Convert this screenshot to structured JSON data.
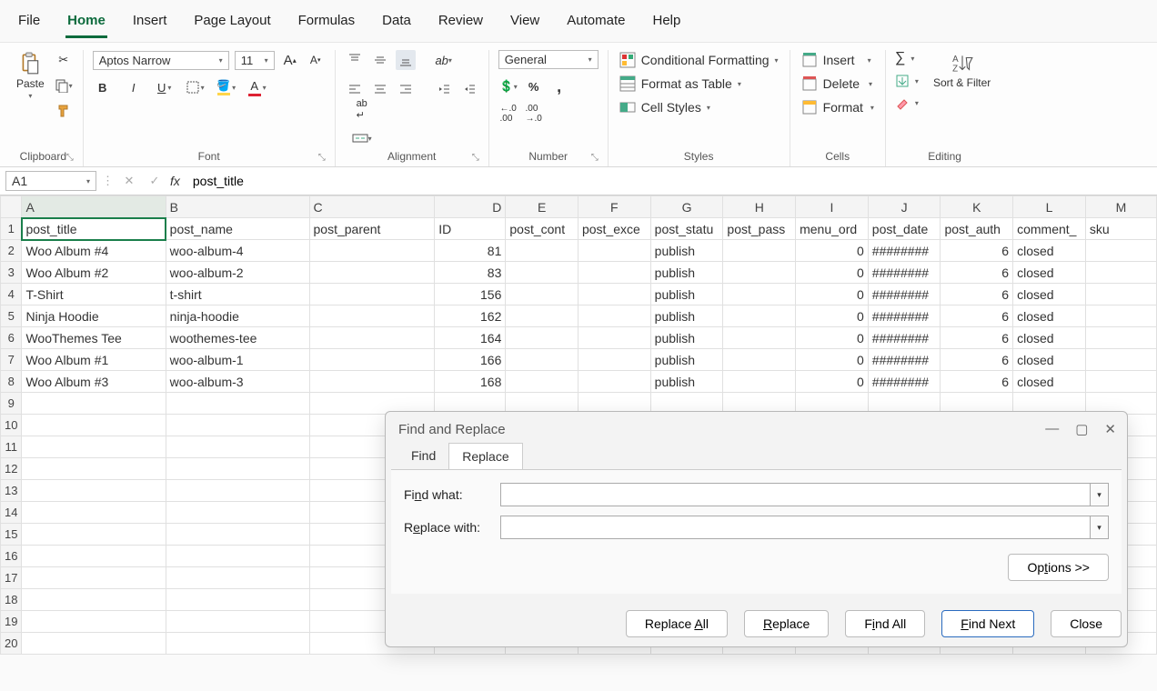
{
  "menu": {
    "tabs": [
      "File",
      "Home",
      "Insert",
      "Page Layout",
      "Formulas",
      "Data",
      "Review",
      "View",
      "Automate",
      "Help"
    ],
    "active": "Home"
  },
  "ribbon": {
    "clipboard": {
      "paste": "Paste",
      "label": "Clipboard"
    },
    "font": {
      "name": "Aptos Narrow",
      "size": "11",
      "label": "Font"
    },
    "alignment": {
      "label": "Alignment"
    },
    "number": {
      "format": "General",
      "label": "Number"
    },
    "styles": {
      "cond": "Conditional Formatting",
      "table": "Format as Table",
      "cell": "Cell Styles",
      "label": "Styles"
    },
    "cells": {
      "insert": "Insert",
      "delete": "Delete",
      "format": "Format",
      "label": "Cells"
    },
    "editing": {
      "sort": "Sort & Filter",
      "label": "Editing"
    }
  },
  "formula_bar": {
    "name_box": "A1",
    "formula": "post_title"
  },
  "columns": [
    "A",
    "B",
    "C",
    "D",
    "E",
    "F",
    "G",
    "H",
    "I",
    "J",
    "K",
    "L",
    "M"
  ],
  "headers": [
    "post_title",
    "post_name",
    "post_parent",
    "ID",
    "post_cont",
    "post_exce",
    "post_statu",
    "post_pass",
    "menu_ord",
    "post_date",
    "post_auth",
    "comment_",
    "sku"
  ],
  "rows": [
    {
      "A": "Woo Album #4",
      "B": "woo-album-4",
      "C": "",
      "D": "81",
      "E": "",
      "F": "",
      "G": "publish",
      "H": "",
      "I": "0",
      "J": "########",
      "K": "6",
      "L": "closed",
      "M": ""
    },
    {
      "A": "Woo Album #2",
      "B": "woo-album-2",
      "C": "",
      "D": "83",
      "E": "",
      "F": "",
      "G": "publish",
      "H": "",
      "I": "0",
      "J": "########",
      "K": "6",
      "L": "closed",
      "M": ""
    },
    {
      "A": "T-Shirt",
      "B": "t-shirt",
      "C": "",
      "D": "156",
      "E": "",
      "F": "",
      "G": "publish",
      "H": "",
      "I": "0",
      "J": "########",
      "K": "6",
      "L": "closed",
      "M": ""
    },
    {
      "A": "Ninja Hoodie",
      "B": "ninja-hoodie",
      "C": "",
      "D": "162",
      "E": "",
      "F": "",
      "G": "publish",
      "H": "",
      "I": "0",
      "J": "########",
      "K": "6",
      "L": "closed",
      "M": ""
    },
    {
      "A": "WooThemes Tee",
      "B": "woothemes-tee",
      "C": "",
      "D": "164",
      "E": "",
      "F": "",
      "G": "publish",
      "H": "",
      "I": "0",
      "J": "########",
      "K": "6",
      "L": "closed",
      "M": ""
    },
    {
      "A": "Woo Album #1",
      "B": "woo-album-1",
      "C": "",
      "D": "166",
      "E": "",
      "F": "",
      "G": "publish",
      "H": "",
      "I": "0",
      "J": "########",
      "K": "6",
      "L": "closed",
      "M": ""
    },
    {
      "A": "Woo Album #3",
      "B": "woo-album-3",
      "C": "",
      "D": "168",
      "E": "",
      "F": "",
      "G": "publish",
      "H": "",
      "I": "0",
      "J": "########",
      "K": "6",
      "L": "closed",
      "M": ""
    }
  ],
  "empty_row_count": 12,
  "dialog": {
    "title": "Find and Replace",
    "tabs": {
      "find": "Find",
      "replace": "Replace",
      "active": "Replace"
    },
    "find_label": "Find what:",
    "replace_label": "Replace with:",
    "find_value": "",
    "replace_value": "",
    "options": "Options >>",
    "buttons": {
      "replace_all": "Replace All",
      "replace": "Replace",
      "find_all": "Find All",
      "find_next": "Find Next",
      "close": "Close"
    }
  }
}
